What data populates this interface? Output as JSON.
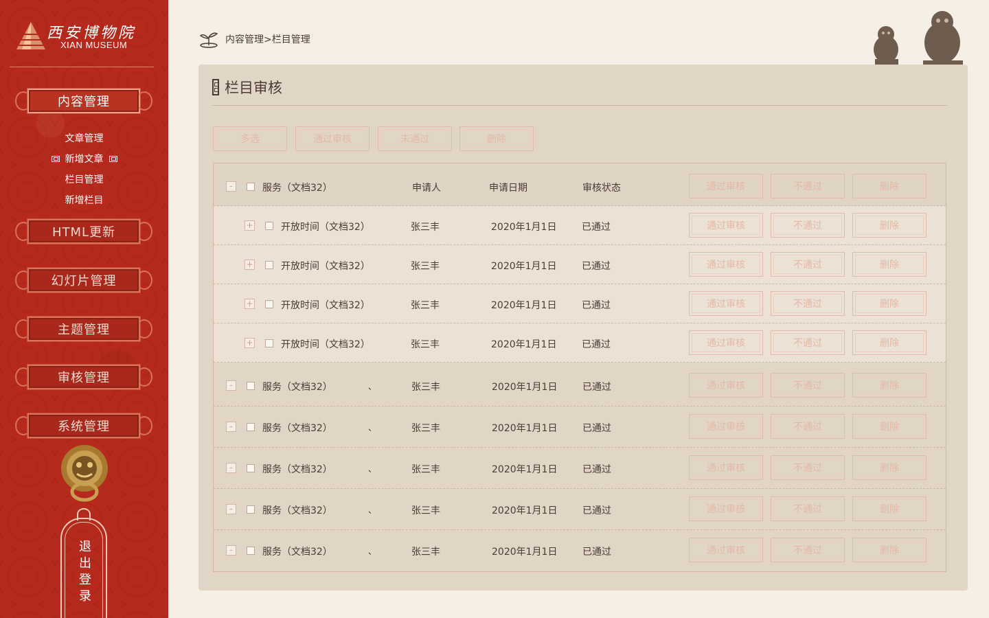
{
  "brand": {
    "name_cn": "西安博物院",
    "name_en": "XIAN MUSEUM"
  },
  "sidebar": {
    "active_menu": "内容管理",
    "submenu": [
      "文章管理",
      "新增文章",
      "栏目管理",
      "新增栏目"
    ],
    "menus": [
      "HTML更新",
      "幻灯片管理",
      "主题管理",
      "审核管理",
      "系统管理"
    ],
    "logout": "退出登录"
  },
  "breadcrumb": "内容管理>栏目管理",
  "panel": {
    "title": "栏目审核",
    "toolbar": [
      "多选",
      "通过审核",
      "未通过",
      "删除"
    ]
  },
  "table": {
    "header": {
      "name": "服务（文档32）",
      "applicant": "申请人",
      "date": "申请日期",
      "status": "审核状态"
    },
    "actions": [
      "通过审核",
      "不通过",
      "删除"
    ],
    "sub_rows": [
      {
        "name": "开放时间（文档32）",
        "applicant": "张三丰",
        "date": "2020年1月1日",
        "status": "已通过"
      },
      {
        "name": "开放时间（文档32）",
        "applicant": "张三丰",
        "date": "2020年1月1日",
        "status": "已通过"
      },
      {
        "name": "开放时间（文档32）",
        "applicant": "张三丰",
        "date": "2020年1月1日",
        "status": "已通过"
      },
      {
        "name": "开放时间（文档32）",
        "applicant": "张三丰",
        "date": "2020年1月1日",
        "status": "已通过"
      }
    ],
    "parent_rows": [
      {
        "name": "服务（文档32）",
        "mark": "、",
        "applicant": "张三丰",
        "date": "2020年1月1日",
        "status": "已通过"
      },
      {
        "name": "服务（文档32）",
        "mark": "、",
        "applicant": "张三丰",
        "date": "2020年1月1日",
        "status": "已通过"
      },
      {
        "name": "服务（文档32）",
        "mark": "、",
        "applicant": "张三丰",
        "date": "2020年1月1日",
        "status": "已通过"
      },
      {
        "name": "服务（文档32）",
        "mark": "、",
        "applicant": "张三丰",
        "date": "2020年1月1日",
        "status": "已通过"
      },
      {
        "name": "服务（文档32）",
        "mark": "、",
        "applicant": "张三丰",
        "date": "2020年1月1日",
        "status": "已通过"
      }
    ],
    "toggle_expand": "+",
    "toggle_collapse": "-"
  },
  "colors": {
    "sidebar_red": "#b52a1c",
    "panel_bg": "#e1d6c6",
    "accent_pink": "#e4b8a6",
    "text_brown": "#4a3b33"
  }
}
